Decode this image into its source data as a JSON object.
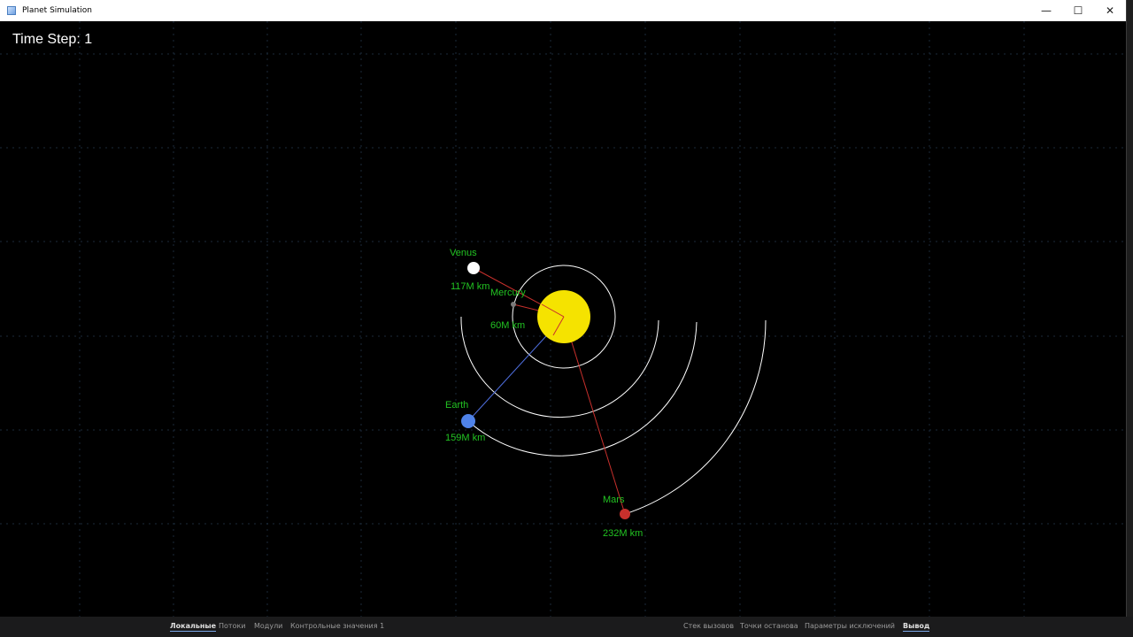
{
  "window": {
    "title": "Planet Simulation",
    "controls": {
      "minimize": "—",
      "maximize": "☐",
      "close": "✕"
    }
  },
  "hud": {
    "time_step": "Time Step: 1"
  },
  "bodies": {
    "sun": {
      "color": "#f5e300"
    },
    "planets": [
      {
        "id": "mercury",
        "name": "Mercury",
        "distance": "60M km",
        "color": "#7a7a7a"
      },
      {
        "id": "venus",
        "name": "Venus",
        "distance": "117M km",
        "color": "#ffffff"
      },
      {
        "id": "earth",
        "name": "Earth",
        "distance": "159M km",
        "color": "#4f82e8"
      },
      {
        "id": "mars",
        "name": "Mars",
        "distance": "232M km",
        "color": "#c8302c"
      }
    ],
    "label_color": "#22c322",
    "orbit_color": "#ffffff",
    "force_line_color": "#c8302c",
    "earth_line_color": "#4f6fe0"
  },
  "debug_tabs_left": [
    {
      "label": "Локальные",
      "active": true
    },
    {
      "label": "Потоки",
      "active": false
    },
    {
      "label": "Модули",
      "active": false
    },
    {
      "label": "Контрольные значения 1",
      "active": false
    }
  ],
  "debug_tabs_right": [
    {
      "label": "Стек вызовов",
      "active": false
    },
    {
      "label": "Точки останова",
      "active": false
    },
    {
      "label": "Параметры исключений",
      "active": false
    },
    {
      "label": "Вывод",
      "active": true
    }
  ]
}
